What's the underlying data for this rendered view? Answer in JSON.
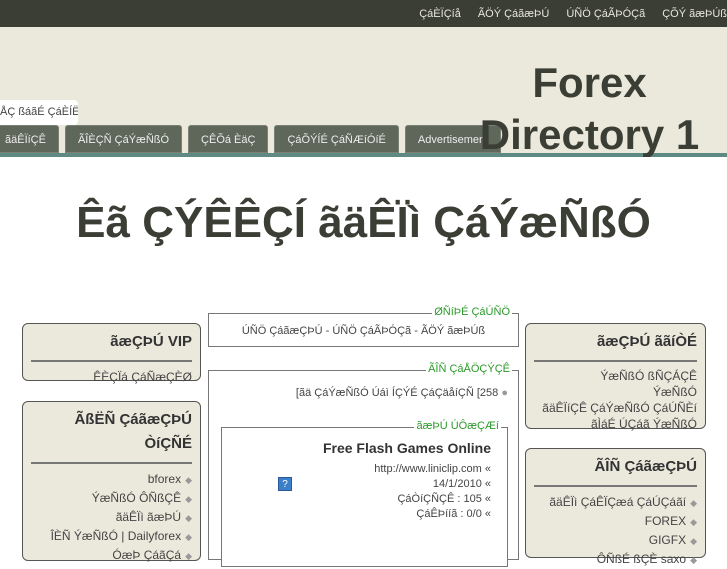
{
  "topnav": [
    "ÇáÈÏÇíå",
    "ÃÖÝ ÇáãæÞÚ",
    "ÚÑÖ ÇáÃÞÓÇã",
    "ÇÕÝ ãæÞÚß"
  ],
  "header": {
    "search_text": "ÅÇ ßáãÉ ÇáÈÍË",
    "tabs": [
      "ãäÊÏíÇÊ",
      "ÃÎÈÇÑ ÇáÝæÑßÓ",
      "ÇÊÕá ÈäÇ",
      "ÇáÕÝÍÉ ÇáÑÆíÓíÉ",
      "Advertisement"
    ],
    "logo": "Forex Directory 1"
  },
  "title": "Êã ÇÝÊÊÇÍ ãäÊÏì ÇáÝæÑßÓ",
  "left": [
    {
      "title": "ãæÇÞÚ VIP",
      "items": [
        "ÊÈÇÏá ÇáÑæÇÈØ"
      ]
    },
    {
      "title": "ÃßËÑ ÇáãæÇÞÚ ÒíÇÑÉ",
      "items": [
        "bforex",
        "ÝæÑßÓ ÔÑßÇÊ",
        "ãäÊÏì ãæÞÚ",
        "ÎÈÑ ÝæÑßÓ | Dailyforex",
        "ÓæÞ ÇáãÇá"
      ]
    }
  ],
  "center": {
    "nav_legend": "ØÑíÞÉ ÇáÚÑÖ",
    "nav_text": "ÚÑÖ ÇáãæÇÞÚ - ÚÑÖ ÇáÃÞÓÇã - ÃÖÝ ãæÞÚß",
    "latest_legend": "ÃÎÑ ÇáÅÖÇÝÇÊ",
    "latest_text": "[ãä ÇáÝæÑßÓ Úáì ÍÇÝÉ ÇáÇäåíÇÑ [258",
    "site_legend": "ãæÞÚ ÚÔæÇÆí",
    "site_title": "Free Flash Games Online",
    "site_url": "http://www.liniclip.com «",
    "site_date": "14/1/2010 «",
    "site_visits": "ÇáÒíÇÑÇÊ : 105 «",
    "site_rating": "ÇáÊÞííã : 0/0 «",
    "img_placeholder": "?"
  },
  "right": [
    {
      "title": "ãæÇÞÚ ããíÒÉ",
      "items": [
        "ÝæÑßÓ ßÑÇÁÇÊ",
        "ÝæÑßÓ",
        "ãäÊÏíÇÊ ÇáÝæÑßÓ ÇáÚÑÈí",
        "ãÌáÉ ÚÇáã ÝæÑßÓ"
      ]
    },
    {
      "title": "ÃÎÑ ÇáãæÇÞÚ",
      "items": [
        "ãäÊÏì ÇáÊÏÇæá ÇáÚÇáãí",
        "FOREX",
        "GIGFX",
        "ÔÑßÉ ßÇÈ saxo"
      ]
    }
  ]
}
